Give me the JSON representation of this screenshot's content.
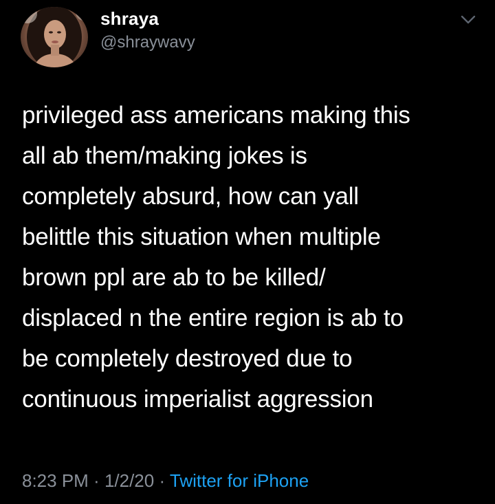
{
  "user": {
    "display_name": "shraya",
    "handle": "@shraywavy"
  },
  "tweet": {
    "lines": [
      "privileged ass americans making this",
      "all ab them/making jokes is",
      "completely absurd, how can yall",
      "belittle this situation when multiple",
      "brown ppl are ab to be killed/",
      "displaced n the entire region is ab to",
      "be completely destroyed due to",
      "continuous imperialist aggression"
    ]
  },
  "meta": {
    "time": "8:23 PM",
    "separator": " · ",
    "date": "1/2/20",
    "source": "Twitter for iPhone"
  },
  "icons": {
    "menu": "chevron-down-icon",
    "avatar": "avatar"
  },
  "colors": {
    "background": "#000000",
    "text": "#ffffff",
    "secondary": "#8a9099",
    "link": "#1da1f2"
  }
}
